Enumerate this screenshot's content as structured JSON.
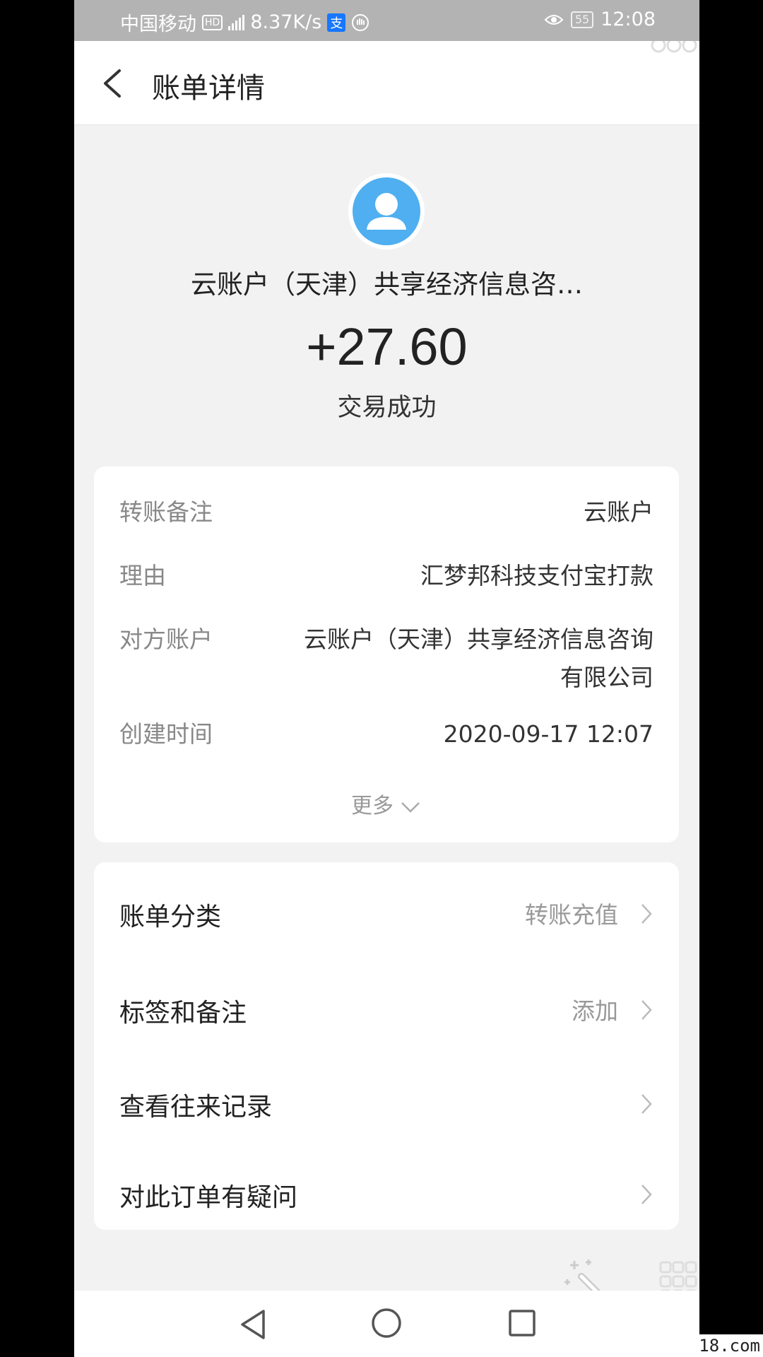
{
  "status_bar": {
    "carrier": "中国移动",
    "hd_badge": "HD",
    "network_speed": "8.37K/s",
    "alipay_glyph": "支",
    "battery": "55",
    "time": "12:08"
  },
  "header": {
    "title": "账单详情"
  },
  "summary": {
    "payee": "云账户（天津）共享经济信息咨…",
    "amount": "+27.60",
    "status": "交易成功"
  },
  "details": [
    {
      "label": "转账备注",
      "value_lines": [
        "云账户"
      ]
    },
    {
      "label": "理由",
      "value_lines": [
        "汇梦邦科技支付宝打款"
      ]
    },
    {
      "label": "对方账户",
      "value_lines": [
        "云账户（天津）共享经济信息咨询",
        "有限公司"
      ]
    },
    {
      "label": "创建时间",
      "value_lines": [
        "2020-09-17 12:07"
      ]
    }
  ],
  "more_label": "更多",
  "actions": [
    {
      "title": "账单分类",
      "value": "转账充值"
    },
    {
      "title": "标签和备注",
      "value": "添加"
    },
    {
      "title": "查看往来记录",
      "value": ""
    },
    {
      "title": "对此订单有疑问",
      "value": ""
    }
  ],
  "watermark": "18.com",
  "colors": {
    "accent_avatar": "#4faff0",
    "background": "#f2f2f2",
    "status_bar": "#b3b3b3"
  }
}
